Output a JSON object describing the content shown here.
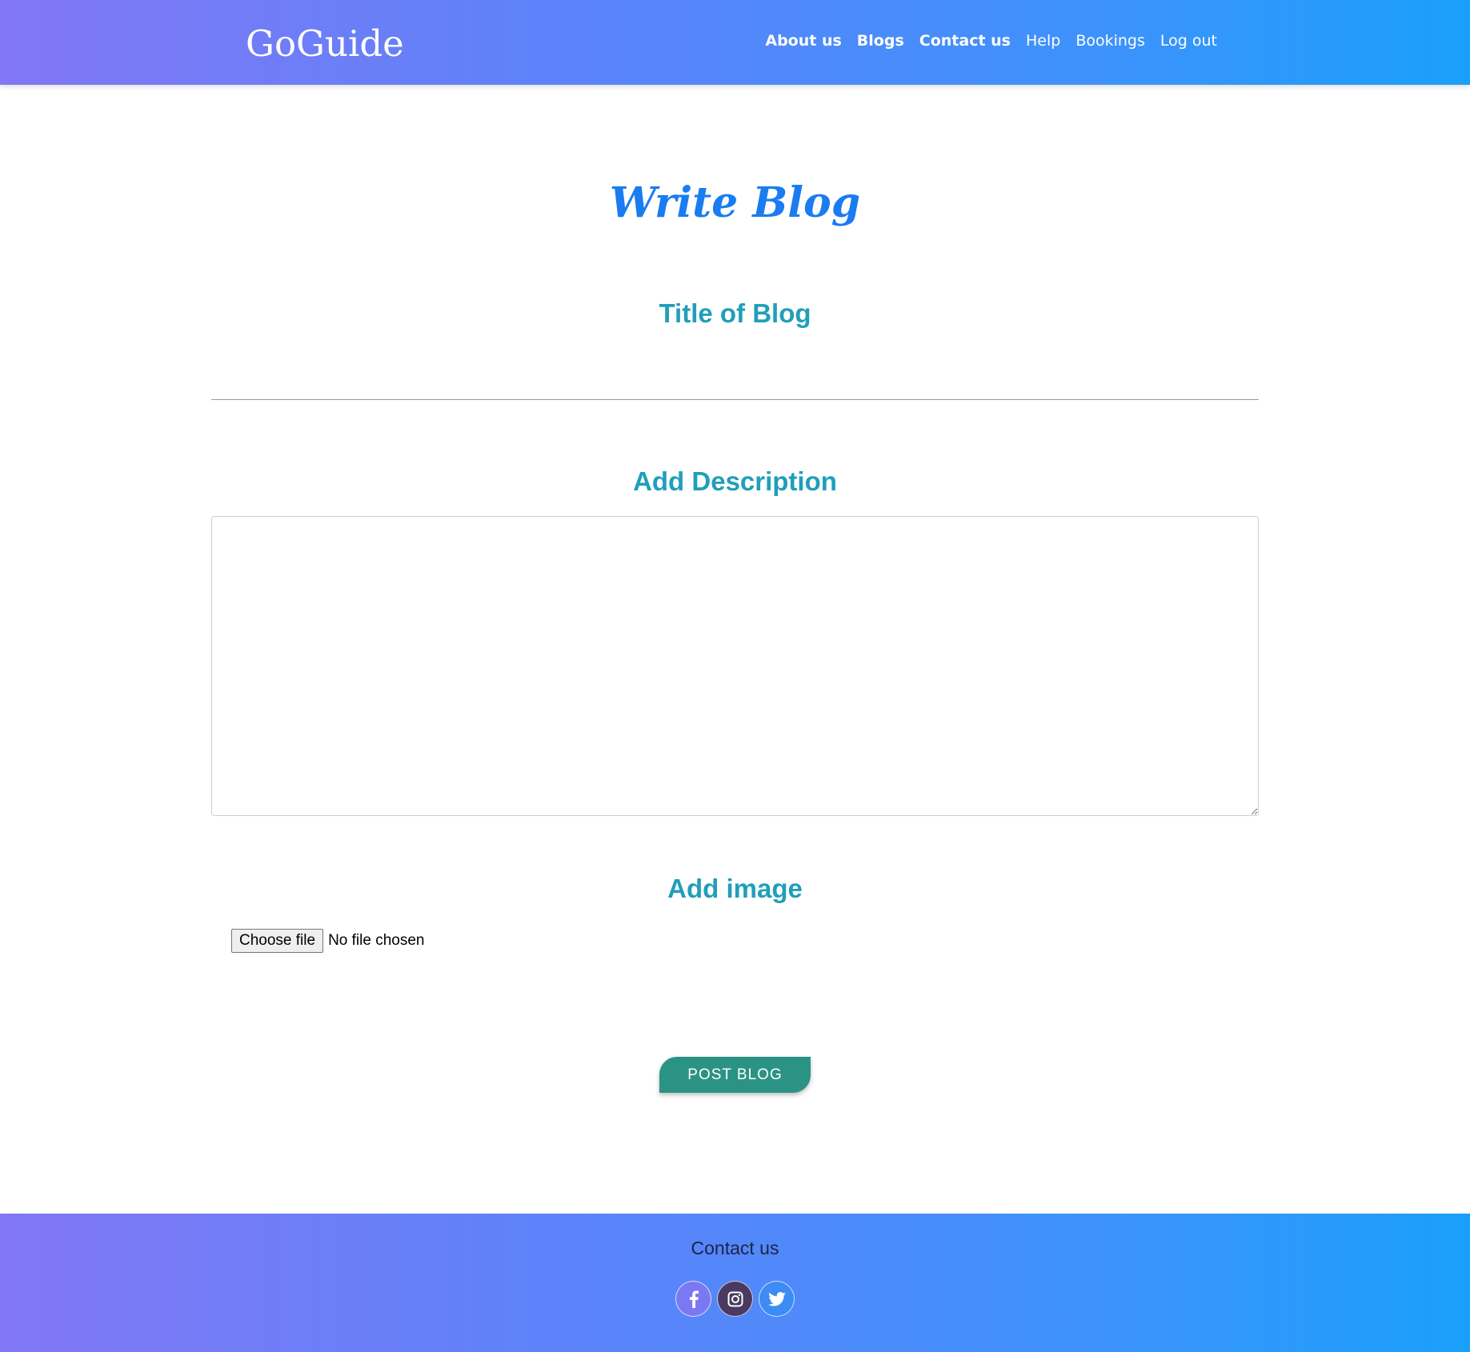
{
  "header": {
    "logo": "GoGuide",
    "nav": [
      {
        "label": "About us"
      },
      {
        "label": "Blogs"
      },
      {
        "label": "Contact us"
      },
      {
        "label": "Help"
      },
      {
        "label": "Bookings"
      },
      {
        "label": "Log out"
      }
    ]
  },
  "main": {
    "page_title": "Write Blog",
    "title_label": "Title of Blog",
    "title_value": "",
    "description_label": "Add Description",
    "description_value": "",
    "image_label": "Add image",
    "file_button_label": "Choose file",
    "file_status": "No file chosen",
    "post_button_label": "POST BLOG"
  },
  "footer": {
    "title": "Contact us",
    "socials": [
      {
        "icon": "facebook-icon"
      },
      {
        "icon": "instagram-icon"
      },
      {
        "icon": "twitter-icon"
      }
    ]
  },
  "colors": {
    "header_gradient_start": "#8277f5",
    "header_gradient_end": "#1aa0fb",
    "page_title": "#1a7cf0",
    "section_label": "#1f9fba",
    "post_button": "#2b9384"
  }
}
